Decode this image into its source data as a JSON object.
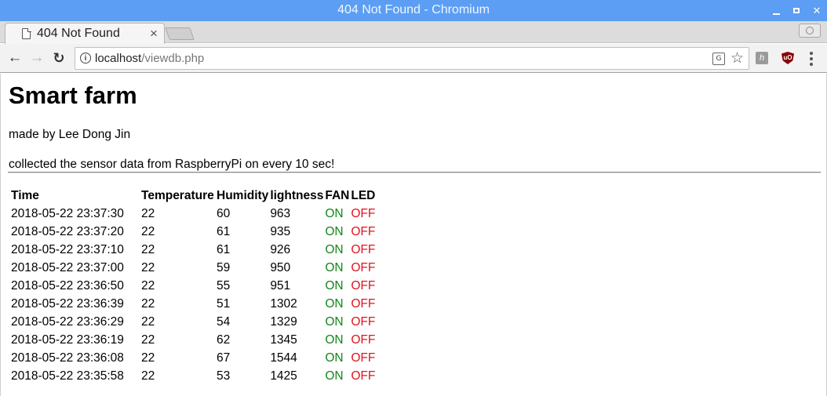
{
  "window": {
    "title": "404 Not Found - Chromium"
  },
  "tab": {
    "label": "404 Not Found",
    "close_symbol": "×"
  },
  "toolbar": {
    "url_host": "localhost",
    "url_path": "/viewdb.php"
  },
  "icons": {
    "tab": "page-icon",
    "back": "arrow-left-icon",
    "forward": "arrow-right-icon",
    "reload": "reload-icon",
    "info": "info-icon",
    "translate": "translate-icon",
    "bookmark": "star-icon",
    "extension_1": "extension-icon",
    "extension_2": "ublock-icon",
    "menu": "kebab-menu-icon",
    "profile": "profile-icon"
  },
  "colors": {
    "titlebar": "#5b9ef4",
    "on": "#11871a",
    "off": "#e0141e"
  },
  "page": {
    "heading": "Smart farm",
    "author": "made by Lee Dong Jin",
    "description": "collected the sensor data from RaspberryPi on every 10 sec!",
    "table": {
      "headers": [
        "Time",
        "Temperature",
        "Humidity",
        "lightness",
        "FAN",
        "LED"
      ],
      "rows": [
        [
          "2018-05-22 23:37:30",
          "22",
          "60",
          "963",
          "ON",
          "OFF"
        ],
        [
          "2018-05-22 23:37:20",
          "22",
          "61",
          "935",
          "ON",
          "OFF"
        ],
        [
          "2018-05-22 23:37:10",
          "22",
          "61",
          "926",
          "ON",
          "OFF"
        ],
        [
          "2018-05-22 23:37:00",
          "22",
          "59",
          "950",
          "ON",
          "OFF"
        ],
        [
          "2018-05-22 23:36:50",
          "22",
          "55",
          "951",
          "ON",
          "OFF"
        ],
        [
          "2018-05-22 23:36:39",
          "22",
          "51",
          "1302",
          "ON",
          "OFF"
        ],
        [
          "2018-05-22 23:36:29",
          "22",
          "54",
          "1329",
          "ON",
          "OFF"
        ],
        [
          "2018-05-22 23:36:19",
          "22",
          "62",
          "1345",
          "ON",
          "OFF"
        ],
        [
          "2018-05-22 23:36:08",
          "22",
          "67",
          "1544",
          "ON",
          "OFF"
        ],
        [
          "2018-05-22 23:35:58",
          "22",
          "53",
          "1425",
          "ON",
          "OFF"
        ]
      ]
    }
  }
}
